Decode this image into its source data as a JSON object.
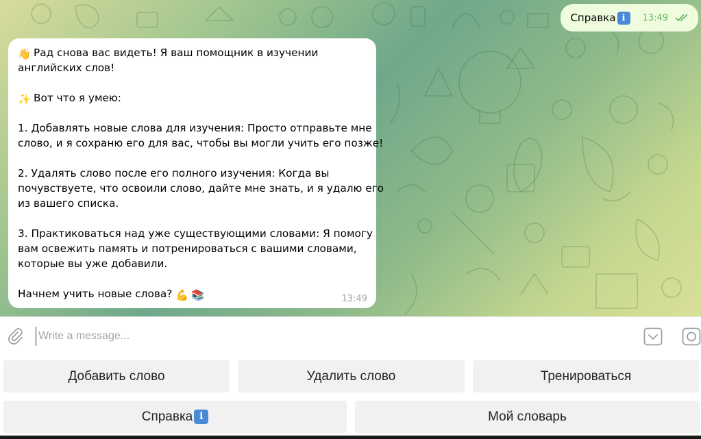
{
  "outgoing_message": {
    "text": "Справка",
    "time": "13:49",
    "status_icon": "double-check-icon"
  },
  "incoming_message": {
    "lines": [
      "Рад снова вас видеть! Я ваш помощник в изучении",
      "английских слов!",
      "",
      "Вот что я умею:",
      "",
      "1. Добавлять новые слова для изучения: Просто отправьте мне",
      "слово, и я сохраню его для вас, чтобы вы могли учить его позже!",
      "",
      "2. Удалять слово после его полного изучения: Когда вы",
      "почувствуете, что освоили слово, дайте мне знать, и я удалю его",
      "из вашего списка.",
      "",
      "3. Практиковаться над уже существующими словами: Я помогу",
      "вам освежить память и потренироваться с вашими словами,",
      "которые вы уже добавили.",
      "",
      "Начнем учить новые слова?"
    ],
    "time": "13:49"
  },
  "composer": {
    "placeholder": "Write a message...",
    "value": ""
  },
  "keyboard": {
    "buttons": [
      {
        "label": "Добавить слово"
      },
      {
        "label": "Удалить слово"
      },
      {
        "label": "Тренироваться"
      },
      {
        "label": "Справка"
      },
      {
        "label": "Мой словарь"
      }
    ]
  },
  "colors": {
    "outgoing_bubble": "#effdde",
    "incoming_bubble": "#ffffff",
    "keyboard_button": "#f1f1f1",
    "check_color": "#6ab560"
  }
}
